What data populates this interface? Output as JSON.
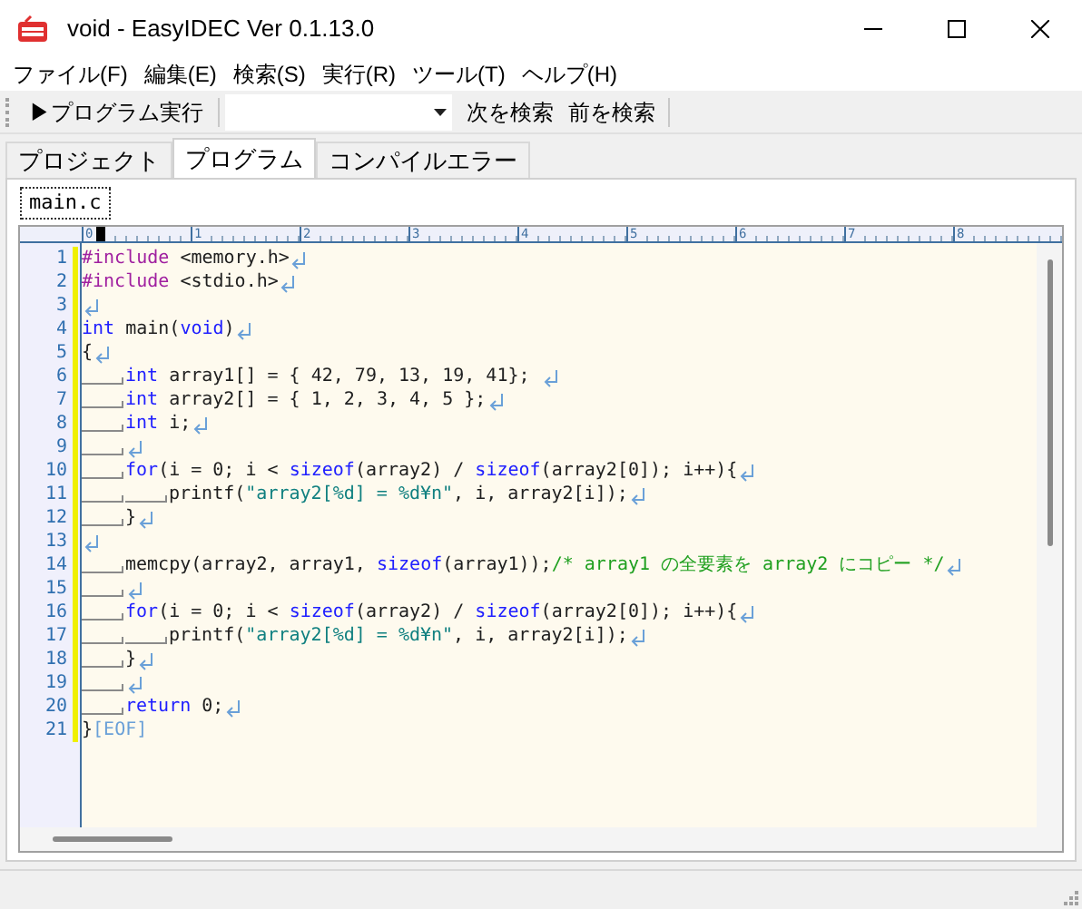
{
  "window": {
    "title": "void - EasyIDEC Ver 0.1.13.0"
  },
  "menu": [
    "ファイル(F)",
    "編集(E)",
    "検索(S)",
    "実行(R)",
    "ツール(T)",
    "ヘルプ(H)"
  ],
  "toolbar": {
    "run_button": "▶プログラム実行",
    "find_next": "次を検索",
    "find_prev": "前を検索"
  },
  "tabs": [
    {
      "label": "プロジェクト",
      "selected": false
    },
    {
      "label": "プログラム",
      "selected": true
    },
    {
      "label": "コンパイルエラー",
      "selected": false
    }
  ],
  "file_tabs": [
    {
      "label": "main.c",
      "selected": true
    }
  ],
  "ruler": {
    "labels": [
      "0",
      "1",
      "2",
      "3",
      "4",
      "5",
      "6",
      "7",
      "8"
    ]
  },
  "editor": {
    "lines": [
      {
        "number": "1",
        "tokens": [
          {
            "kind": "preproc",
            "text": "#include"
          },
          {
            "kind": "text",
            "text": " <memory.h>"
          },
          {
            "kind": "newline"
          }
        ]
      },
      {
        "number": "2",
        "tokens": [
          {
            "kind": "preproc",
            "text": "#include"
          },
          {
            "kind": "text",
            "text": " <stdio.h>"
          },
          {
            "kind": "newline"
          }
        ]
      },
      {
        "number": "3",
        "tokens": [
          {
            "kind": "newline"
          }
        ]
      },
      {
        "number": "4",
        "tokens": [
          {
            "kind": "keyword",
            "text": "int"
          },
          {
            "kind": "text",
            "text": " main("
          },
          {
            "kind": "keyword",
            "text": "void"
          },
          {
            "kind": "text",
            "text": ")"
          },
          {
            "kind": "newline"
          }
        ]
      },
      {
        "number": "5",
        "tokens": [
          {
            "kind": "text",
            "text": "{"
          },
          {
            "kind": "newline"
          }
        ]
      },
      {
        "number": "6",
        "tokens": [
          {
            "kind": "tab"
          },
          {
            "kind": "keyword",
            "text": "int"
          },
          {
            "kind": "text",
            "text": " array1[] = { 42, 79, 13, 19, 41}; "
          },
          {
            "kind": "newline"
          }
        ]
      },
      {
        "number": "7",
        "tokens": [
          {
            "kind": "tab"
          },
          {
            "kind": "keyword",
            "text": "int"
          },
          {
            "kind": "text",
            "text": " array2[] = { 1, 2, 3, 4, 5 };"
          },
          {
            "kind": "newline"
          }
        ]
      },
      {
        "number": "8",
        "tokens": [
          {
            "kind": "tab"
          },
          {
            "kind": "keyword",
            "text": "int"
          },
          {
            "kind": "text",
            "text": " i;"
          },
          {
            "kind": "newline"
          }
        ]
      },
      {
        "number": "9",
        "tokens": [
          {
            "kind": "tab"
          },
          {
            "kind": "newline"
          }
        ]
      },
      {
        "number": "10",
        "tokens": [
          {
            "kind": "tab"
          },
          {
            "kind": "keyword",
            "text": "for"
          },
          {
            "kind": "text",
            "text": "(i = 0; i < "
          },
          {
            "kind": "keyword",
            "text": "sizeof"
          },
          {
            "kind": "text",
            "text": "(array2) / "
          },
          {
            "kind": "keyword",
            "text": "sizeof"
          },
          {
            "kind": "text",
            "text": "(array2[0]); i++){"
          },
          {
            "kind": "newline"
          }
        ]
      },
      {
        "number": "11",
        "tokens": [
          {
            "kind": "tab"
          },
          {
            "kind": "tab"
          },
          {
            "kind": "text",
            "text": "printf("
          },
          {
            "kind": "string",
            "text": "\"array2[%d] = %d¥n\""
          },
          {
            "kind": "text",
            "text": ", i, array2[i]);"
          },
          {
            "kind": "newline"
          }
        ]
      },
      {
        "number": "12",
        "tokens": [
          {
            "kind": "tab"
          },
          {
            "kind": "text",
            "text": "}"
          },
          {
            "kind": "newline"
          }
        ]
      },
      {
        "number": "13",
        "tokens": [
          {
            "kind": "newline"
          }
        ]
      },
      {
        "number": "14",
        "tokens": [
          {
            "kind": "tab"
          },
          {
            "kind": "text",
            "text": "memcpy(array2, array1, "
          },
          {
            "kind": "keyword",
            "text": "sizeof"
          },
          {
            "kind": "text",
            "text": "(array1));"
          },
          {
            "kind": "comment",
            "text": "/* array1 の全要素を array2 にコピー */"
          },
          {
            "kind": "newline"
          }
        ]
      },
      {
        "number": "15",
        "tokens": [
          {
            "kind": "tab"
          },
          {
            "kind": "newline"
          }
        ]
      },
      {
        "number": "16",
        "tokens": [
          {
            "kind": "tab"
          },
          {
            "kind": "keyword",
            "text": "for"
          },
          {
            "kind": "text",
            "text": "(i = 0; i < "
          },
          {
            "kind": "keyword",
            "text": "sizeof"
          },
          {
            "kind": "text",
            "text": "(array2) / "
          },
          {
            "kind": "keyword",
            "text": "sizeof"
          },
          {
            "kind": "text",
            "text": "(array2[0]); i++){"
          },
          {
            "kind": "newline"
          }
        ]
      },
      {
        "number": "17",
        "tokens": [
          {
            "kind": "tab"
          },
          {
            "kind": "tab"
          },
          {
            "kind": "text",
            "text": "printf("
          },
          {
            "kind": "string",
            "text": "\"array2[%d] = %d¥n\""
          },
          {
            "kind": "text",
            "text": ", i, array2[i]);"
          },
          {
            "kind": "newline"
          }
        ]
      },
      {
        "number": "18",
        "tokens": [
          {
            "kind": "tab"
          },
          {
            "kind": "text",
            "text": "}"
          },
          {
            "kind": "newline"
          }
        ]
      },
      {
        "number": "19",
        "tokens": [
          {
            "kind": "tab"
          },
          {
            "kind": "newline"
          }
        ]
      },
      {
        "number": "20",
        "tokens": [
          {
            "kind": "tab"
          },
          {
            "kind": "keyword",
            "text": "return"
          },
          {
            "kind": "text",
            "text": " 0;"
          },
          {
            "kind": "newline"
          }
        ]
      },
      {
        "number": "21",
        "tokens": [
          {
            "kind": "text",
            "text": "}"
          },
          {
            "kind": "eof",
            "text": "[EOF]"
          }
        ]
      }
    ]
  }
}
